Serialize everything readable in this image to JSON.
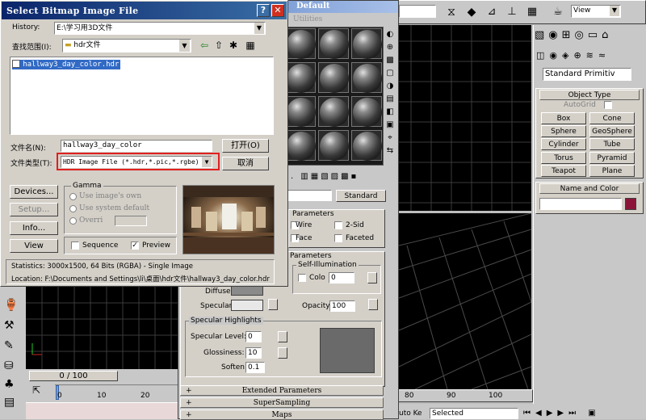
{
  "dialog": {
    "title": "Select Bitmap Image File",
    "history_label": "History:",
    "history_value": "E:\\学习用3D文件",
    "lookin_label": "查找范围(I):",
    "lookin_value": "hdr文件",
    "file_item": "hallway3_day_color.hdr",
    "filename_label": "文件名(N):",
    "filename_value": "hallway3_day_color",
    "filetype_label": "文件类型(T):",
    "filetype_value": "HDR Image File (*.hdr,*.pic,*.rgbe)",
    "open_label": "打开(O)",
    "cancel_label": "取消",
    "devices_label": "Devices...",
    "setup_label": "Setup...",
    "info_label": "Info...",
    "view_label": "View",
    "gamma_title": "Gamma",
    "gamma_opt1": "Use image's own",
    "gamma_opt2": "Use system default",
    "gamma_opt3": "Overri",
    "sequence_label": "Sequence",
    "preview_label": "Preview",
    "statistics": "Statistics:  3000x1500, 64 Bits (RGBA) - Single Image",
    "location": "Location:  F:\\Documents and Settings\\li\\桌面\\hdr文件\\hallway3_day_color.hdr"
  },
  "material_editor": {
    "title_fragment": "Default",
    "menu_fragment": "Utilities",
    "standard_label": "Standard",
    "basic_params": "Parameters",
    "wire": "Wire",
    "two_sided": "2-Sid",
    "face": "Face",
    "faceted": "Faceted",
    "params2": "Parameters",
    "self_illum": "Self-Illumination",
    "color_label": "Colo",
    "color_value": "0",
    "diffuse": "Diffuse:",
    "specular": "Specular:",
    "opacity_label": "Opacity:",
    "opacity_value": "100",
    "spec_highlights": "Specular Highlights",
    "spec_level_label": "Specular Level:",
    "spec_level_value": "0",
    "glossiness_label": "Glossiness:",
    "glossiness_value": "10",
    "soften_label": "Soften:",
    "soften_value": "0.1",
    "extended": "Extended Parameters",
    "supersampling": "SuperSampling",
    "maps": "Maps",
    "slot_coords": "o."
  },
  "viewport": {
    "view_label": "View",
    "timeline": "0 / 100",
    "ruler": [
      "0",
      "10",
      "20"
    ],
    "ruler_right": [
      "80",
      "90",
      "100"
    ],
    "key_label": "uto Ke",
    "selected_label": "Selected"
  },
  "command_panel": {
    "dropdown": "Standard Primitiv",
    "object_type": "Object Type",
    "autogrid": "AutoGrid",
    "buttons": [
      "Box",
      "Cone",
      "Sphere",
      "GeoSphere",
      "Cylinder",
      "Tube",
      "Torus",
      "Pyramid",
      "Teapot",
      "Plane"
    ],
    "name_color": "Name and Color",
    "color_swatch": "#8b1538"
  },
  "colors": {
    "title_active": "#0a246a",
    "title_blue": "#3a6ea5",
    "highlight_red": "#e02020",
    "selection": "#316ac5"
  }
}
